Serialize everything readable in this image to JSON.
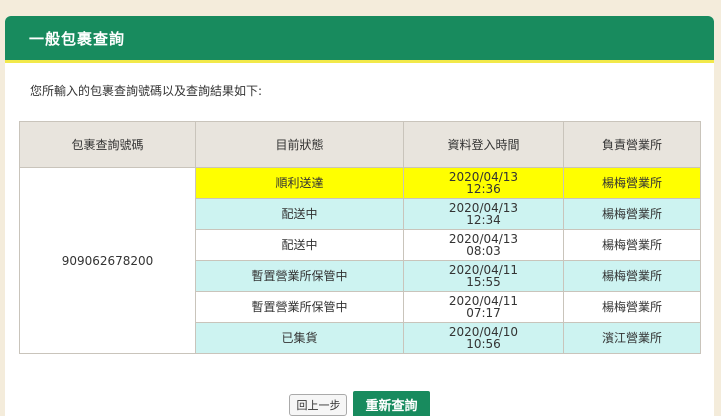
{
  "panel": {
    "title": "一般包裹查詢"
  },
  "intro": "您所輸入的包裹查詢號碼以及查詢結果如下:",
  "table": {
    "headers": [
      "包裹查詢號碼",
      "目前狀態",
      "資料登入時間",
      "負責營業所"
    ],
    "tracking_number": "909062678200",
    "rows": [
      {
        "status": "順利送達",
        "date": "2020/04/13",
        "time": "12:36",
        "office": "楊梅營業所"
      },
      {
        "status": "配送中",
        "date": "2020/04/13",
        "time": "12:34",
        "office": "楊梅營業所"
      },
      {
        "status": "配送中",
        "date": "2020/04/13",
        "time": "08:03",
        "office": "楊梅營業所"
      },
      {
        "status": "暫置營業所保管中",
        "date": "2020/04/11",
        "time": "15:55",
        "office": "楊梅營業所"
      },
      {
        "status": "暫置營業所保管中",
        "date": "2020/04/11",
        "time": "07:17",
        "office": "楊梅營業所"
      },
      {
        "status": "已集貨",
        "date": "2020/04/10",
        "time": "10:56",
        "office": "濱江營業所"
      }
    ]
  },
  "buttons": {
    "back": "回上一步",
    "requery": "重新查詢"
  },
  "colors": {
    "header": "#188b5e",
    "accent": "#f2e94a",
    "highlight": "#ffff00",
    "alt_row": "#cdf3f1"
  }
}
